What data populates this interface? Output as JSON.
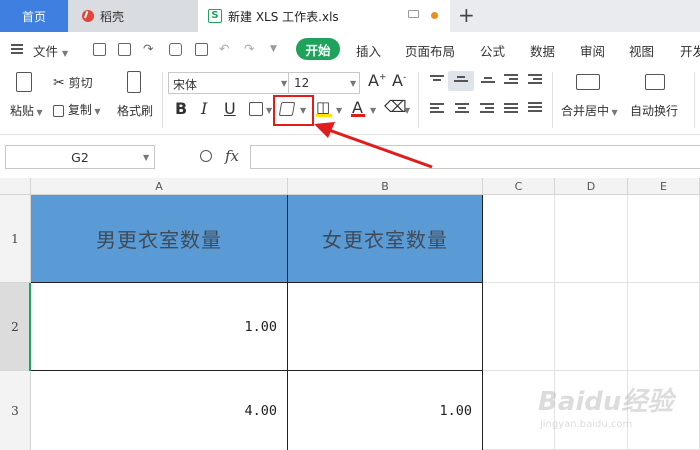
{
  "tabs": {
    "home": "首页",
    "daoke": "稻壳",
    "file": "新建 XLS 工作表.xls",
    "new_tab": "+"
  },
  "menu": {
    "file": "文件",
    "start": "开始",
    "items": [
      "插入",
      "页面布局",
      "公式",
      "数据",
      "审阅",
      "视图",
      "开发"
    ]
  },
  "ribbon": {
    "paste": "粘贴",
    "cut": "剪切",
    "copy": "复制",
    "format_painter": "格式刷",
    "font_name": "宋体",
    "font_size": "12",
    "grow_font": "A",
    "shrink_font": "A",
    "bold": "B",
    "italic": "I",
    "underline": "U",
    "font_color": "A",
    "merge_center": "合并居中",
    "wrap_text": "自动换行"
  },
  "formula": {
    "namebox": "G2",
    "fx": "fx",
    "value": ""
  },
  "grid": {
    "columns": [
      "A",
      "B",
      "C",
      "D",
      "E"
    ],
    "rows": [
      "1",
      "2",
      "3"
    ],
    "cells": {
      "A1": "男更衣室数量",
      "B1": "女更衣室数量",
      "A2": "1.00",
      "B2": "",
      "A3": "4.00",
      "B3": "1.00"
    }
  },
  "colors": {
    "header_fill": "#5b9bd5",
    "accent_green": "#1fa35c",
    "tab_blue": "#3f7fe0",
    "annotation_red": "#e21b1b"
  },
  "watermark": {
    "logo": "Baidu经验",
    "url": "jingyan.baidu.com"
  }
}
